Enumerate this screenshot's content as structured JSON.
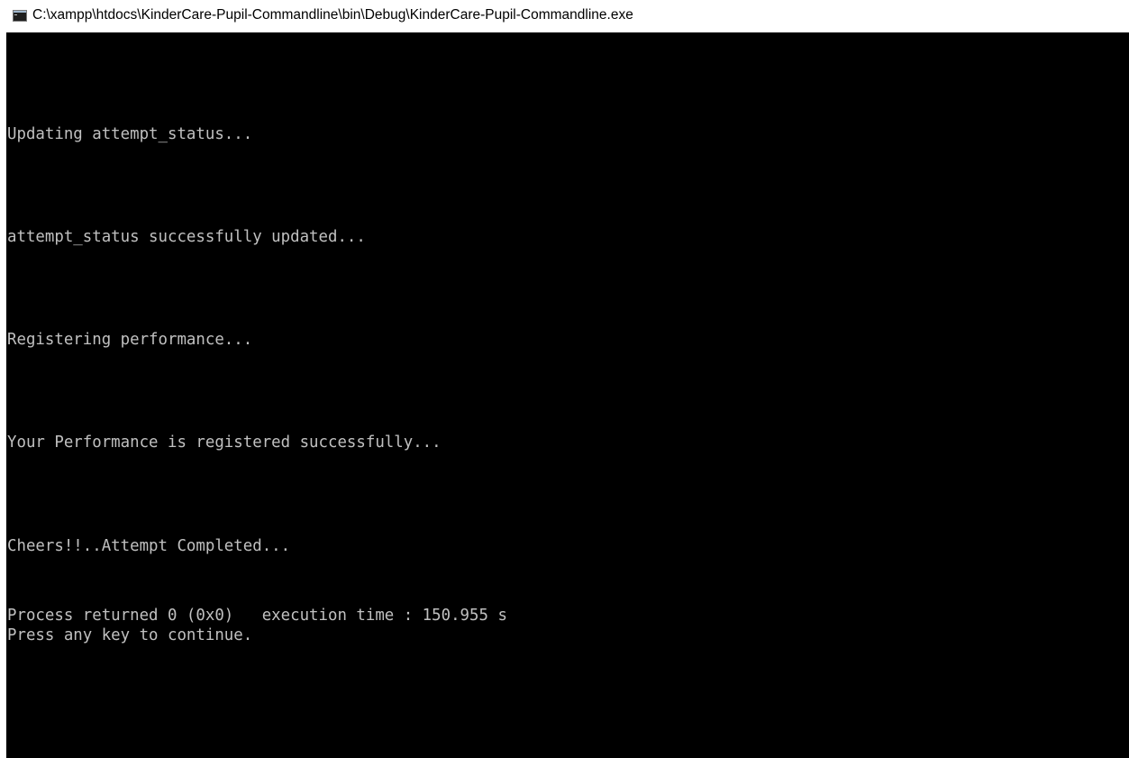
{
  "window": {
    "title": "C:\\xampp\\htdocs\\KinderCare-Pupil-Commandline\\bin\\Debug\\KinderCare-Pupil-Commandline.exe",
    "icon": "console-app-icon"
  },
  "console": {
    "lines": [
      "Updating attempt_status...",
      "attempt_status successfully updated...",
      "Registering performance...",
      "Your Performance is registered successfully...",
      "Cheers!!..Attempt Completed...",
      "Process returned 0 (0x0)   execution time : 150.955 s",
      "Press any key to continue."
    ]
  },
  "colors": {
    "console_background": "#000000",
    "console_text": "#c0c0c0",
    "titlebar_background": "#ffffff"
  }
}
